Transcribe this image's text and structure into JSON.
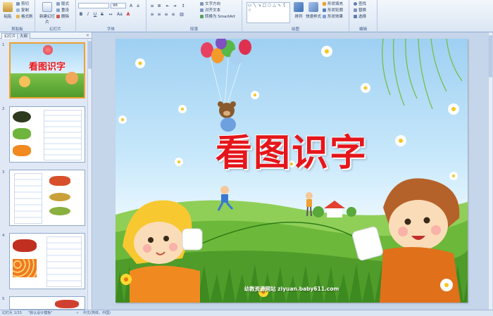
{
  "ribbon": {
    "clipboard": {
      "paste": "粘贴",
      "cut": "剪切",
      "copy": "复制",
      "format_painter": "格式刷",
      "label": "剪贴板"
    },
    "slides": {
      "new_slide": "新建幻灯片",
      "layout": "版式",
      "reset": "重设",
      "delete": "删除",
      "label": "幻灯片"
    },
    "font": {
      "size": "96",
      "label": "字体"
    },
    "paragraph": {
      "text_direction": "文字方向",
      "align_text": "对齐文本",
      "smartart": "转换为 SmartArt",
      "label": "段落"
    },
    "drawing": {
      "arrange": "排列",
      "quick_styles": "快速样式",
      "shape_fill": "形状填充",
      "shape_outline": "形状轮廓",
      "shape_effects": "形状效果",
      "label": "绘图"
    },
    "editing": {
      "find": "查找",
      "replace": "替换",
      "select": "选择",
      "label": "编辑"
    }
  },
  "panel": {
    "tab_slides": "幻灯片",
    "tab_outline": "大纲",
    "close": "×",
    "slide_numbers": [
      "1",
      "2",
      "3",
      "4",
      "5"
    ],
    "thumb1_title": "看图识字"
  },
  "slide": {
    "title": "看图识字",
    "footer": "幼教资源网站  ziyuan.baby611.com"
  },
  "status": {
    "slide_info": "幻灯片 1/33",
    "theme": "\"默认设计模板\"",
    "language": "中文(简体，中国)"
  },
  "colors": {
    "title_red": "#e5161b",
    "ribbon_bg": "#dbe6f4",
    "selection_orange": "#f0a030"
  }
}
